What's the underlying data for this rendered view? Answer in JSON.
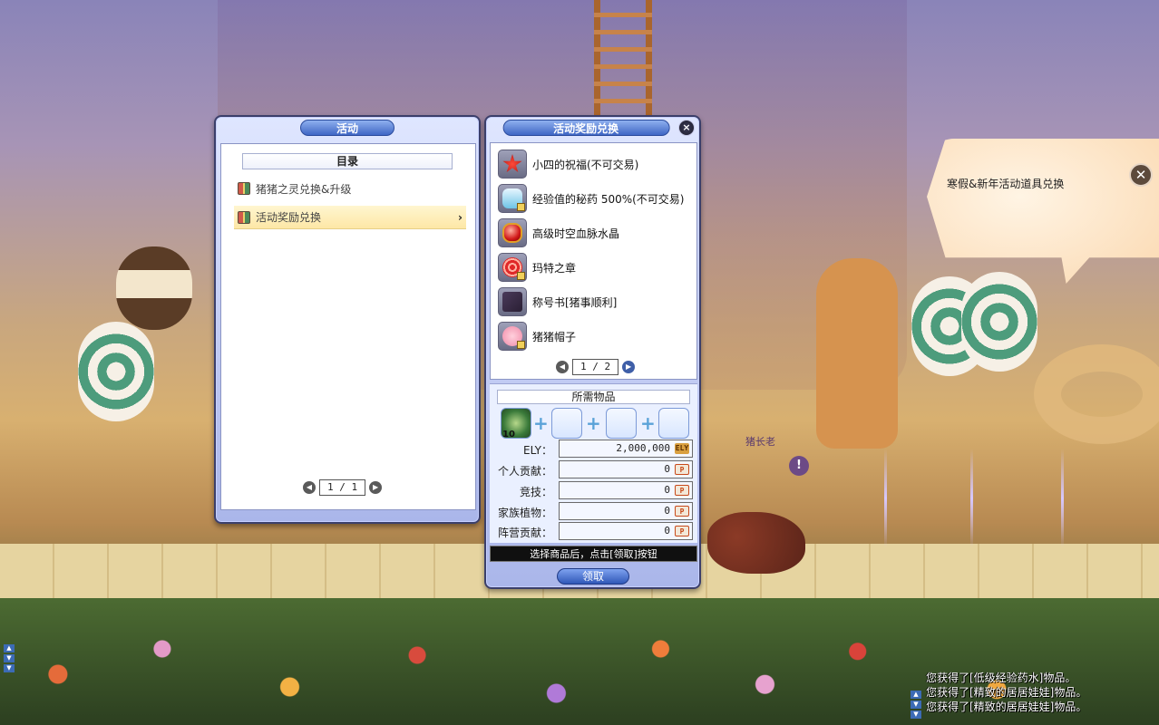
{
  "left_panel": {
    "title": "活动",
    "catalog_header": "目录",
    "items": [
      {
        "label": "猪猪之灵兑换&升级",
        "selected": false
      },
      {
        "label": "活动奖励兑换",
        "selected": true
      }
    ],
    "page_current": "1",
    "page_total": "1",
    "page_text": "1 / 1"
  },
  "right_panel": {
    "title": "活动奖励兑换",
    "close": "×",
    "rewards": [
      {
        "label": "小四的祝福(不可交易)",
        "icon": "red-star-icon"
      },
      {
        "label": "经验值的秘药 500%(不可交易)",
        "icon": "potion-icon"
      },
      {
        "label": "高级时空血脉水晶",
        "icon": "red-crystal-icon"
      },
      {
        "label": "玛特之章",
        "icon": "red-seal-icon"
      },
      {
        "label": "称号书[猪事顺利]",
        "icon": "title-book-icon"
      },
      {
        "label": "猪猪帽子",
        "icon": "pig-hat-icon"
      }
    ],
    "page_text": "1 / 2",
    "required_header": "所需物品",
    "required_item_count": "10",
    "costs": [
      {
        "label": "ELY：",
        "value": "2,000,000",
        "currency": "ELY"
      },
      {
        "label": "个人贡献：",
        "value": "0",
        "currency": "P"
      },
      {
        "label": "竞技：",
        "value": "0",
        "currency": "P"
      },
      {
        "label": "家族植物：",
        "value": "0",
        "currency": "P"
      },
      {
        "label": "阵营贡献：",
        "value": "0",
        "currency": "P"
      }
    ],
    "hint": "选择商品后，点击[领取]按钮",
    "claim_button": "领取"
  },
  "npc_bubble": {
    "text": "寒假&新年活动道具兑换",
    "close": "✕"
  },
  "scene": {
    "npc_name": "猪长老"
  },
  "chat": {
    "lines": [
      "您获得了[低级经验药水]物品。",
      "您获得了[精致的居居娃娃]物品。",
      "您获得了[精致的居居娃娃]物品。"
    ]
  },
  "colors": {
    "title_bar": "#3f66c4",
    "selected_item_bg": "#fde7a6",
    "hint_bar": "#101010"
  }
}
